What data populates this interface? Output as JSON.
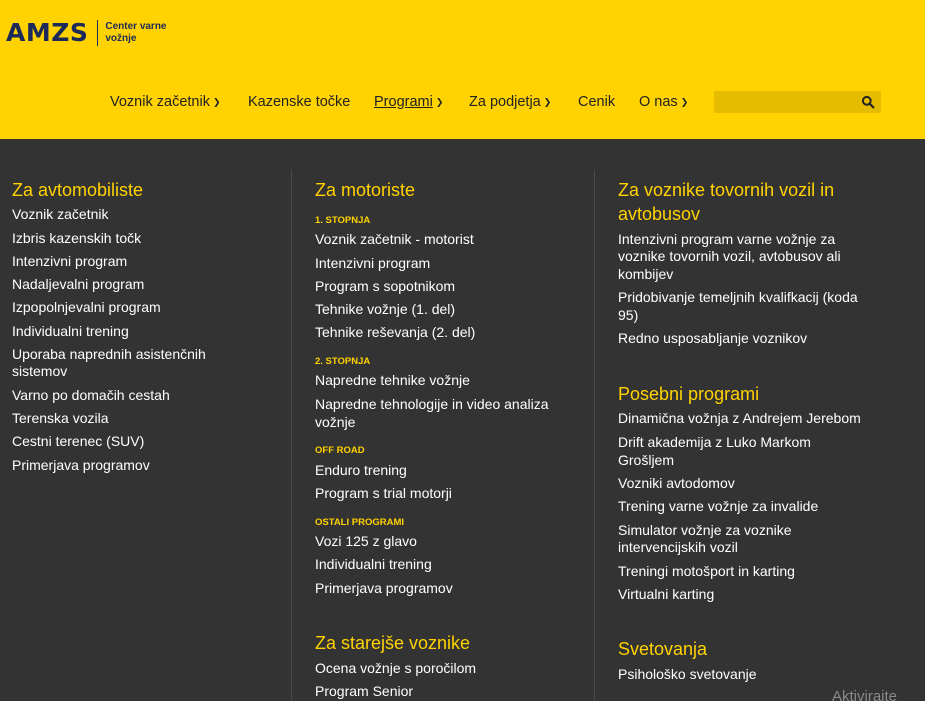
{
  "header": {
    "logo_text": "AMZS",
    "logo_sub_line1": "Center varne",
    "logo_sub_line2": "vožnje"
  },
  "nav": {
    "items": [
      {
        "label": "Voznik začetnik",
        "dropdown": true
      },
      {
        "label": "Kazenske točke",
        "dropdown": false
      },
      {
        "label": "Programi",
        "dropdown": true,
        "active": true
      },
      {
        "label": "Za podjetja",
        "dropdown": true
      },
      {
        "label": "Cenik",
        "dropdown": false
      },
      {
        "label": "O nas",
        "dropdown": true
      }
    ],
    "search_placeholder": ""
  },
  "col1": {
    "heading": "Za avtomobiliste",
    "links": [
      "Voznik začetnik",
      "Izbris kazenskih točk",
      "Intenzivni program",
      "Nadaljevalni program",
      "Izpopolnjevalni program",
      "Individualni trening",
      "Uporaba naprednih asistenčnih",
      "sistemov",
      "Varno po domačih cestah",
      "Terenska vozila",
      "Cestni terenec (SUV)",
      "Primerjava programov"
    ]
  },
  "col2": {
    "heading": "Za motoriste",
    "sub1": "1. STOPNJA",
    "sub1_links": [
      "Voznik začetnik - motorist",
      "Intenzivni program",
      "Program s sopotnikom",
      "Tehnike vožnje (1. del)",
      "Tehnike reševanja (2. del)"
    ],
    "sub2": "2. STOPNJA",
    "sub2_links": [
      "Napredne tehnike vožnje",
      "Napredne tehnologije in video analiza",
      "vožnje"
    ],
    "sub3": "OFF ROAD",
    "sub3_links": [
      "Enduro trening",
      "Program s trial motorji"
    ],
    "sub4": "OSTALI PROGRAMI",
    "sub4_links": [
      "Vozi 125 z glavo",
      "Individualni trening",
      "Primerjava programov"
    ],
    "heading2": "Za starejše voznike",
    "heading2_links": [
      "Ocena vožnje s poročilom",
      "Program Senior"
    ]
  },
  "col3": {
    "heading_line1": "Za voznike tovornih vozil in",
    "heading_line2": "avtobusov",
    "links": [
      "Intenzivni program varne vožnje za",
      "voznike tovornih vozil, avtobusov ali",
      "kombijev",
      "Pridobivanje temeljnih kvalifkacij (koda",
      "95)",
      "Redno usposabljanje voznikov"
    ],
    "heading2": "Posebni programi",
    "links2": [
      "Dinamična vožnja z Andrejem Jerebom",
      "Drift akademija z Luko Markom",
      "Grošljem",
      "Vozniki avtodomov",
      "Trening varne vožnje za invalide",
      "Simulator vožnje za voznike",
      "intervencijskih vozil",
      "Treningi motošport in karting",
      "Virtualni karting"
    ],
    "heading3": "Svetovanja",
    "links3": [
      "Psihološko svetovanje"
    ]
  },
  "watermark": "Aktivirajte",
  "colors": {
    "brand_yellow": "#ffd200",
    "panel_dark": "#333333",
    "logo_navy": "#1b2a58"
  }
}
